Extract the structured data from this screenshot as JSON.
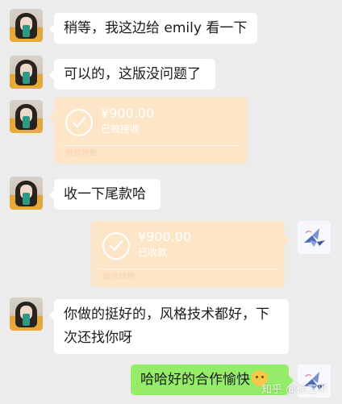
{
  "messages": {
    "m1": "稍等，我这边给 emily 看一下",
    "m2": "可以的，这版没问题了",
    "m4": "收一下尾款哈",
    "m6": "你做的挺好的，风格技术都好，下次还找你呀",
    "m7": "哈哈好的合作愉快"
  },
  "transfers": {
    "t1": {
      "amount": "¥900.00",
      "status": "已被接收",
      "label": "微信转账"
    },
    "t2": {
      "amount": "¥900.00",
      "status": "已收款",
      "label": "微信转账"
    }
  },
  "watermark": "知乎 @徐三平",
  "colors": {
    "background": "#ececec",
    "incoming_bubble": "#ffffff",
    "outgoing_bubble": "#95ec69",
    "transfer_card": "#fde5c7"
  }
}
